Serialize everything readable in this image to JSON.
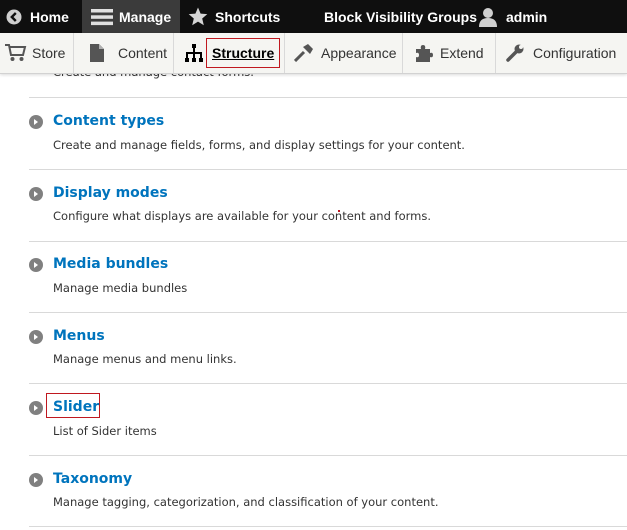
{
  "toolbar": {
    "home": "Home",
    "manage": "Manage",
    "shortcuts": "Shortcuts",
    "block_visibility": "Block Visibility Groups",
    "user": "admin"
  },
  "tray": {
    "store": "Store",
    "content": "Content",
    "structure": "Structure",
    "appearance": "Appearance",
    "extend": "Extend",
    "configuration": "Configuration"
  },
  "list": {
    "cut_description": "Create and manage contact forms.",
    "items": [
      {
        "title": "Content types",
        "description": "Create and manage fields, forms, and display settings for your content."
      },
      {
        "title": "Display modes",
        "description": "Configure what displays are available for your content and forms."
      },
      {
        "title": "Media bundles",
        "description": "Manage media bundles"
      },
      {
        "title": "Menus",
        "description": "Manage menus and menu links."
      },
      {
        "title": "Slider",
        "description": "List of Sider items"
      },
      {
        "title": "Taxonomy",
        "description": "Manage tagging, categorization, and classification of your content."
      }
    ]
  },
  "colors": {
    "link": "#0074bd",
    "toolbar_bg": "#0f0f0f",
    "highlight": "#c0181f"
  }
}
